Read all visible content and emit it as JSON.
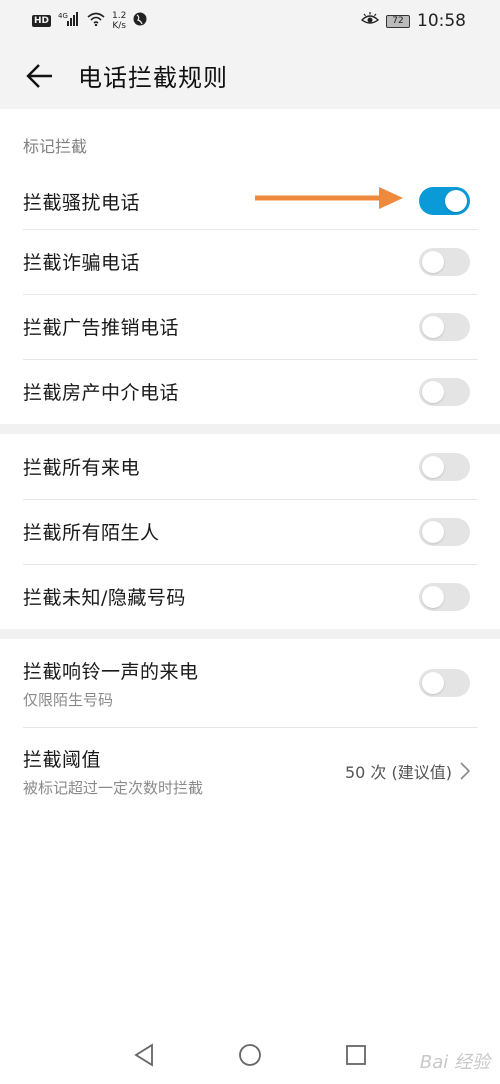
{
  "status_bar": {
    "hd": "HD",
    "network": "4G",
    "speed_value": "1.2",
    "speed_unit": "K/s",
    "battery": "72",
    "time": "10:58"
  },
  "app_bar": {
    "title": "电话拦截规则"
  },
  "section": {
    "header": "标记拦截"
  },
  "groups": [
    {
      "rows": [
        {
          "label": "拦截骚扰电话",
          "toggle_on": true
        },
        {
          "label": "拦截诈骗电话",
          "toggle_on": false
        },
        {
          "label": "拦截广告推销电话",
          "toggle_on": false
        },
        {
          "label": "拦截房产中介电话",
          "toggle_on": false
        }
      ]
    },
    {
      "rows": [
        {
          "label": "拦截所有来电",
          "toggle_on": false
        },
        {
          "label": "拦截所有陌生人",
          "toggle_on": false
        },
        {
          "label": "拦截未知/隐藏号码",
          "toggle_on": false
        }
      ]
    },
    {
      "rows": [
        {
          "label": "拦截响铃一声的来电",
          "sublabel": "仅限陌生号码",
          "toggle_on": false
        },
        {
          "label": "拦截阈值",
          "sublabel": "被标记超过一定次数时拦截",
          "value": "50 次 (建议值)"
        }
      ]
    }
  ],
  "colors": {
    "accent": "#0a9ad8",
    "annotation_arrow": "#ef8a3d",
    "background": "#ffffff",
    "header_bg": "#f3f3f3"
  },
  "icons": {
    "back": "arrow-left-icon",
    "chevron": "chevron-right-icon",
    "nav_back": "triangle-back-icon",
    "nav_home": "circle-home-icon",
    "nav_recents": "square-recents-icon"
  },
  "watermark": "Bai 经验"
}
